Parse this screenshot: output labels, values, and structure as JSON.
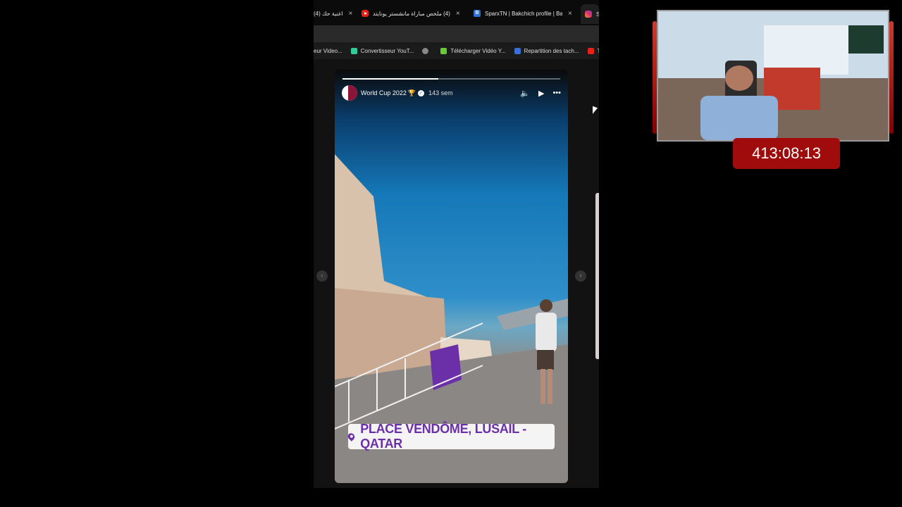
{
  "tabs": [
    {
      "label": "(4) اغنية حك",
      "icon": "none",
      "left": 0
    },
    {
      "label": "(4) ملخص مباراة مانشستر يونايتد",
      "icon": "youtube",
      "left": 0
    },
    {
      "label": "SparxTN | Bakchich profile | Bak",
      "icon": "sparx",
      "left": 0
    },
    {
      "label": "S",
      "icon": "instagram",
      "left": 0
    }
  ],
  "bookmarks": [
    {
      "label": "eur Video...",
      "icon": "none"
    },
    {
      "label": "Convertisseur YouT...",
      "icon": "convert"
    },
    {
      "label": "",
      "icon": "globe"
    },
    {
      "label": "Télécharger Vidéo Y...",
      "icon": "download"
    },
    {
      "label": "Repartition des tach...",
      "icon": "doc"
    },
    {
      "label": "Te",
      "icon": "youtube"
    }
  ],
  "story": {
    "account": "World Cup 2022",
    "time_ago": "143 sem",
    "progress_fraction": 0.44,
    "location": "PLACE VENDÔME, LUSAIL - QATAR"
  },
  "timer": {
    "value": "413:08:13"
  },
  "colors": {
    "location_text": "#6b2fa8",
    "timer_bg": "#a00b0b",
    "qatar_maroon": "#8a1538"
  }
}
